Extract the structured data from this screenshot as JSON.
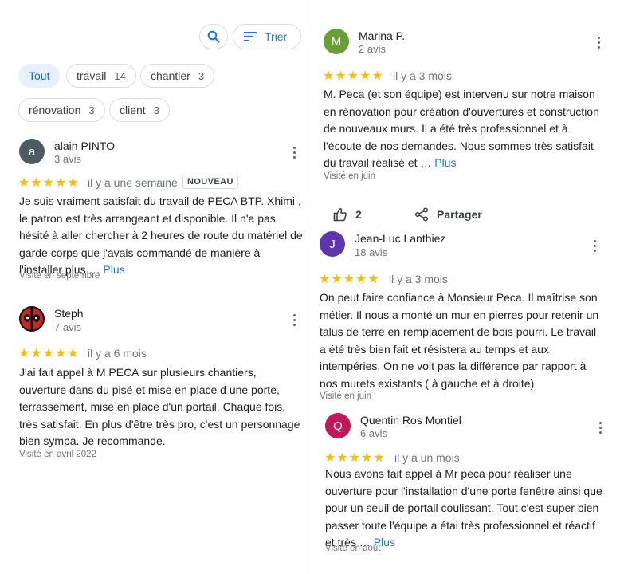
{
  "toolbar": {
    "sort_label": "Trier"
  },
  "filters": [
    {
      "label": "Tout",
      "count": ""
    },
    {
      "label": "travail",
      "count": "14"
    },
    {
      "label": "chantier",
      "count": "3"
    },
    {
      "label": "rénovation",
      "count": "3"
    },
    {
      "label": "client",
      "count": "3"
    }
  ],
  "reviews": [
    {
      "initial": "a",
      "color": "#4f5b62",
      "name": "alain PINTO",
      "sub": "3 avis",
      "stars": "★★★★★",
      "when": "il y a une semaine",
      "badge": "NOUVEAU",
      "lines": [
        "Je suis vraiment satisfait du travail de PECA BTP. Xhimi ,",
        "le patron est très arrangeant et disponible. Il n'a pas",
        "hésité à aller chercher à 2 heures de route du matériel de",
        "garde corps que j'avais commandé de manière à",
        "l'installer plus …"
      ],
      "more": "Plus",
      "visited": "Visité en septembre"
    },
    {
      "initial": "",
      "color": "#111111",
      "name": "Steph",
      "sub": "7 avis",
      "stars": "★★★★★",
      "when": "il y a 6 mois",
      "lines": [
        "J'ai fait appel à M PECA sur plusieurs chantiers,",
        "ouverture dans du pisé et mise en place d une porte,",
        "terrassement,  mise en place d'un portail. Chaque fois,",
        "très satisfait. En plus d'être très pro, c'est un personnage",
        "bien sympa. Je recommande."
      ],
      "visited": "Visité en avril 2022"
    },
    {
      "initial": "M",
      "color": "#689f38",
      "name": "Marina P.",
      "sub": "2 avis",
      "stars": "★★★★★",
      "when": "il y a 3 mois",
      "lines": [
        "M. Peca (et son équipe) est intervenu sur notre maison",
        "en rénovation pour création d'ouvertures et construction",
        "de nouveaux murs. Il a été très professionnel et à",
        "l'écoute de nos demandes. Nous sommes très satisfait",
        "du travail réalisé et …"
      ],
      "more": "Plus",
      "visited": "Visité en juin",
      "likes": "2",
      "share": "Partager"
    },
    {
      "initial": "J",
      "color": "#5e35b1",
      "name": "Jean-Luc Lanthiez",
      "sub": "18 avis",
      "stars": "★★★★★",
      "when": "il y a 3 mois",
      "lines": [
        "On peut faire confiance à Monsieur Peca. Il maîtrise son",
        "métier. Il nous a monté un mur en pierres pour retenir un",
        "talus de terre en remplacement de bois pourri. Le travail",
        "a été très bien fait et résistera au temps et aux",
        "intempéries. On ne voit pas la différence par rapport à",
        "nos murets existants ( à gauche et à droite)"
      ],
      "visited": "Visité en juin"
    },
    {
      "initial": "Q",
      "color": "#c2185b",
      "name": "Quentin Ros Montiel",
      "sub": "6 avis",
      "stars": "★★★★★",
      "when": "il y a un mois",
      "lines": [
        "Nous avons fait appel à Mr peca pour réaliser une",
        "ouverture pour l'installation d'une porte fenêtre ainsi que",
        "pour un seuil de portail coulissant. Tout c'est super bien",
        "passer toute l'équipe a étai très  professionnel et réactif",
        "et très …"
      ],
      "more": "Plus",
      "visited": "Visité en août"
    }
  ]
}
